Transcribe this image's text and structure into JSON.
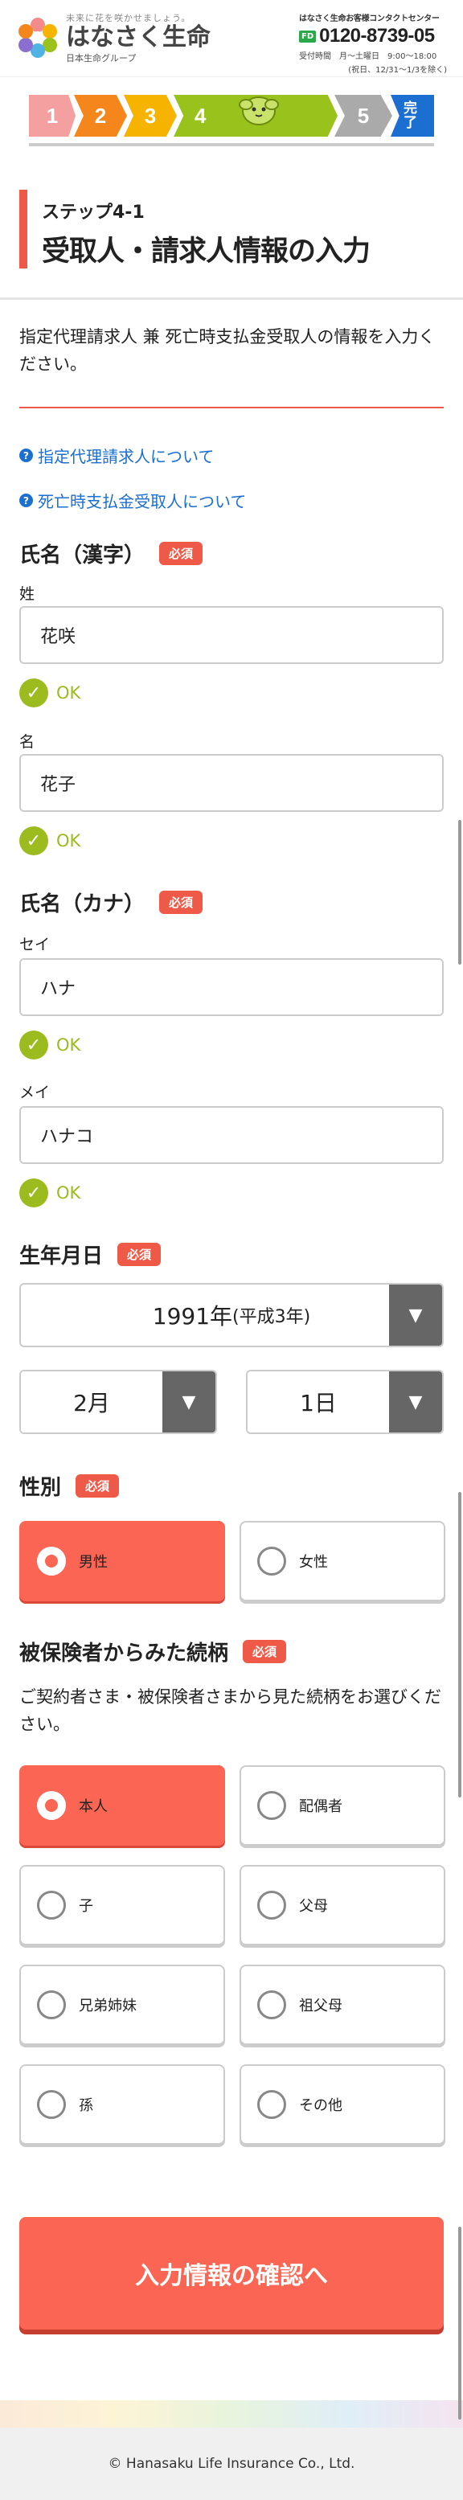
{
  "header": {
    "tagline": "未来に花を咲かせましょう。",
    "brand": "はなさく生命",
    "group": "日本生命グループ",
    "contact_title": "はなさく生命お客様コンタクトセンター",
    "phone_icon": "FD",
    "phone": "0120-8739-05",
    "hours_label": "受付時間",
    "hours_value": "月〜土曜日　9:00〜18:00",
    "hours_note": "(祝日、12/31〜1/3を除く)"
  },
  "steps": [
    {
      "label": "1",
      "color": "#f4a0a0"
    },
    {
      "label": "2",
      "color": "#f4861c"
    },
    {
      "label": "3",
      "color": "#f6b400"
    },
    {
      "label": "4",
      "color": "#9ac21c"
    },
    {
      "label": "5",
      "color": "#aaaaaa"
    },
    {
      "label": "完了",
      "color": "#1a6fd0"
    }
  ],
  "page": {
    "step_sub": "ステップ4-1",
    "title": "受取人・請求人情報の入力",
    "intro": "指定代理請求人 兼 死亡時支払金受取人の情報を入力ください。",
    "help_links": [
      "指定代理請求人について",
      "死亡時支払金受取人について"
    ]
  },
  "required_label": "必須",
  "ok_label": "OK",
  "name_kanji": {
    "label": "氏名（漢字）",
    "sei_label": "姓",
    "sei_value": "花咲",
    "mei_label": "名",
    "mei_value": "花子"
  },
  "name_kana": {
    "label": "氏名（カナ）",
    "sei_label": "セイ",
    "sei_value": "ハナ",
    "mei_label": "メイ",
    "mei_value": "ハナコ"
  },
  "birthdate": {
    "label": "生年月日",
    "year_value": "1991年",
    "year_era": "(平成3年)",
    "month_value": "2月",
    "day_value": "1日"
  },
  "gender": {
    "label": "性別",
    "options": [
      "男性",
      "女性"
    ],
    "selected": "男性"
  },
  "relationship": {
    "label": "被保険者からみた続柄",
    "note": "ご契約者さま・被保険者さまから見た続柄をお選びください。",
    "options": [
      "本人",
      "配偶者",
      "子",
      "父母",
      "兄弟姉妹",
      "祖父母",
      "孫",
      "その他"
    ],
    "selected": "本人"
  },
  "submit_label": "入力情報の確認へ",
  "footer": "© Hanasaku Life Insurance Co., Ltd."
}
